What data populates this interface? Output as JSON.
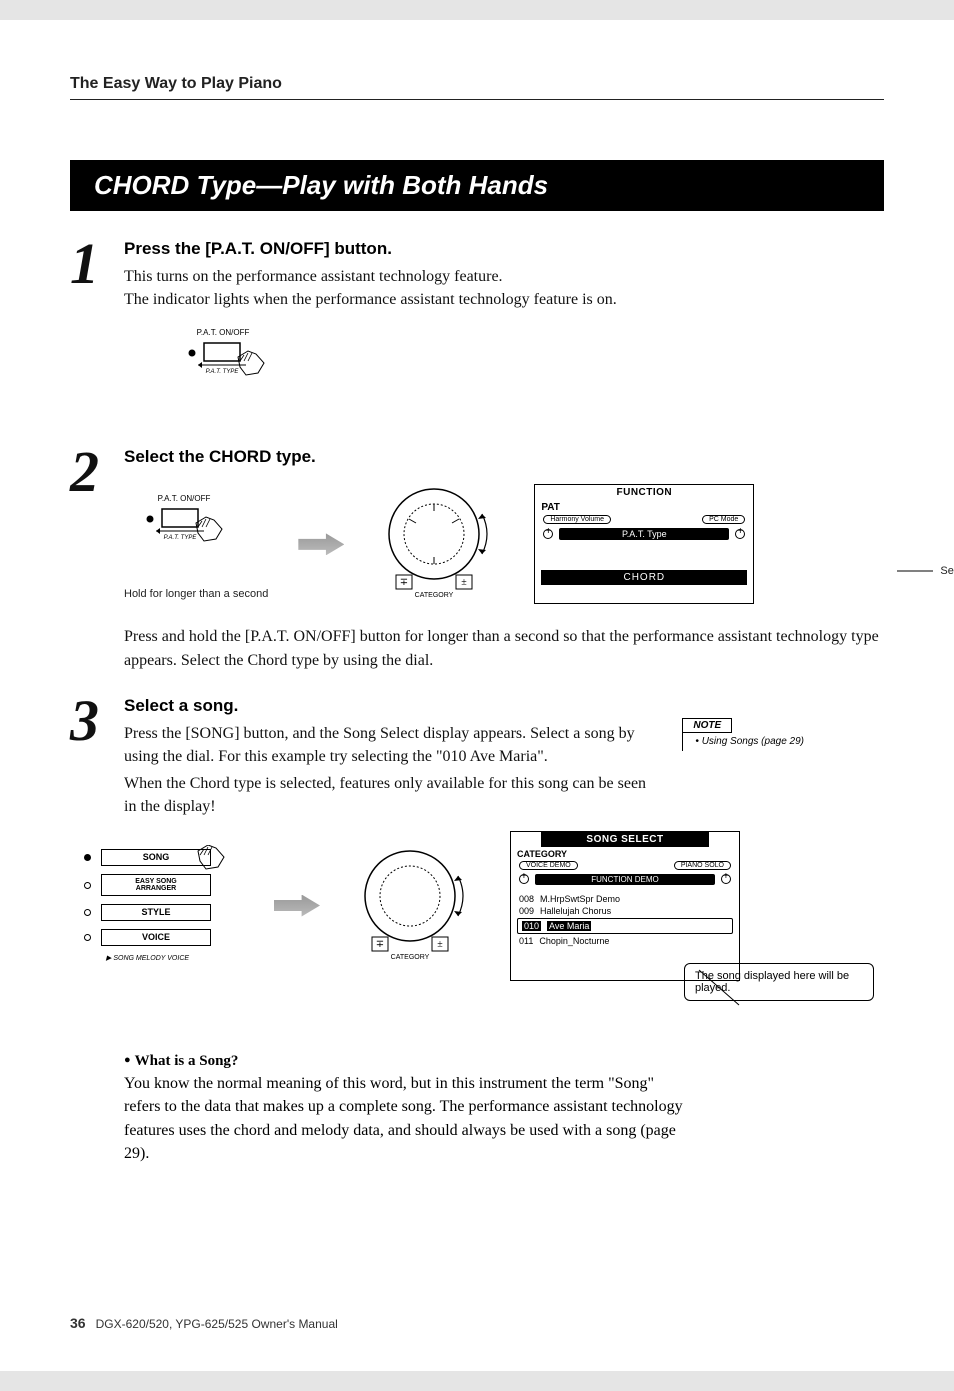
{
  "header": {
    "section": "The Easy Way to Play Piano"
  },
  "banner": {
    "title": "CHORD Type—Play with Both Hands"
  },
  "step1": {
    "num": "1",
    "title": "Press the [P.A.T. ON/OFF] button.",
    "body": "This turns on the performance assistant technology feature.\nThe indicator lights when the performance assistant technology feature is on.",
    "fig_label_top": "P.A.T. ON/OFF",
    "fig_label_bottom": "P.A.T. TYPE"
  },
  "step2": {
    "num": "2",
    "title": "Select the CHORD type.",
    "hold_caption": "Hold for longer than a second",
    "fig2_label_top": "P.A.T. ON/OFF",
    "fig2_label_bottom": "P.A.T. TYPE",
    "dial_bottom": "CATEGORY",
    "lcd": {
      "title": "FUNCTION",
      "pat": "PAT",
      "harmony": "Harmony Volume",
      "pcmode": "PC Mode",
      "pat_type": "P.A.T. Type",
      "chord": "CHORD"
    },
    "select_chord": "Select Chord",
    "body": "Press and hold the [P.A.T. ON/OFF] button for longer than a second so that the performance assistant technology type appears. Select the Chord type by using the dial."
  },
  "step3": {
    "num": "3",
    "title": "Select a song.",
    "body1": "Press the [SONG] button, and the Song Select display appears. Select a song by using the dial. For this example try selecting the \"010 Ave Maria\".",
    "body2": "When the Chord type is selected, features only available for this song can be seen in the display!",
    "buttons": {
      "song": "SONG",
      "easy": "EASY SONG\nARRANGER",
      "style": "STYLE",
      "voice": "VOICE",
      "sublabel": "SONG MELODY VOICE"
    },
    "lcd": {
      "title": "SONG SELECT",
      "category": "CATEGORY",
      "voice_demo": "VOICE DEMO",
      "piano_solo": "PIANO SOLO",
      "func_demo": "FUNCTION DEMO",
      "items": [
        {
          "num": "008",
          "name": "M.HrpSwtSpr Demo"
        },
        {
          "num": "009",
          "name": "Hallelujah Chorus"
        },
        {
          "num": "010",
          "name": "Ave Maria"
        },
        {
          "num": "011",
          "name": "Chopin_Nocturne"
        }
      ]
    },
    "callout": "The song displayed here will be played."
  },
  "note": {
    "heading": "NOTE",
    "body": "• Using Songs (page 29)"
  },
  "what_song": {
    "heading": "What is a Song?",
    "body": "You know the normal meaning of this word, but in this instrument the term \"Song\" refers to the data that makes up a complete song. The performance assistant technology features uses the chord and melody data, and should always be used with a song (page 29)."
  },
  "footer": {
    "page": "36",
    "doc": "DGX-620/520, YPG-625/525  Owner's Manual"
  }
}
